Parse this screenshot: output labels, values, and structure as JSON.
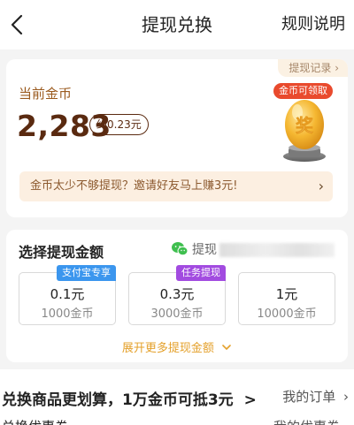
{
  "header": {
    "title": "提现兑换",
    "rule_label": "规则说明",
    "back_icon": "chevron-left-icon"
  },
  "coins_card": {
    "record_label": "提现记录",
    "label": "当前金币",
    "amount": "2,283",
    "approx": "约0.23元",
    "badge": "金币可领取",
    "egg_glyph": "奖",
    "invite_text": "金币太少不够提现？邀请好友马上赚3元!",
    "invite_chevron": "›"
  },
  "withdraw": {
    "title": "选择提现金额",
    "wechat_label": "提现",
    "options": [
      {
        "price": "0.1元",
        "coins": "1000金币",
        "tag": "支付宝专享"
      },
      {
        "price": "0.3元",
        "coins": "3000金币",
        "tag": "任务提现"
      },
      {
        "price": "1元",
        "coins": "10000金币",
        "tag": ""
      }
    ],
    "expand_label": "展开更多提现金额"
  },
  "exchange": {
    "title": "兑换商品更划算，1万金币可抵3元",
    "title_chevron": ">",
    "orders_label": "我的订单",
    "orders_chevron": "›",
    "cut_left": "兑换优惠券",
    "cut_right": "我的优惠券"
  },
  "colors": {
    "accent_brown": "#5a2a10",
    "badge_red": "#e94a2d",
    "expand_gold": "#e4a02a",
    "tag_blue": "#3b96ee",
    "tag_purple": "#a24be0"
  }
}
